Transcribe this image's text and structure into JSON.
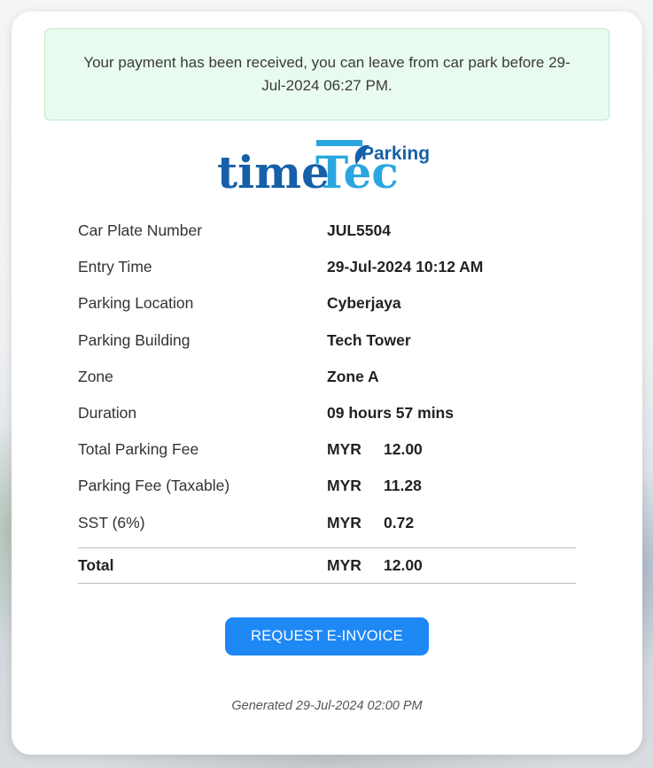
{
  "alert": {
    "message": "Your payment has been received, you can leave from car park before 29-Jul-2024 06:27 PM."
  },
  "logo": {
    "word_time": "time",
    "word_tec": "Tec",
    "word_parking": "Parking",
    "colors": {
      "dark_blue": "#1560a8",
      "light_blue": "#2aa6e0"
    }
  },
  "details": {
    "car_plate": {
      "label": "Car Plate Number",
      "value": "JUL5504"
    },
    "entry_time": {
      "label": "Entry Time",
      "value": "29-Jul-2024 10:12 AM"
    },
    "location": {
      "label": "Parking Location",
      "value": "Cyberjaya"
    },
    "building": {
      "label": "Parking Building",
      "value": "Tech Tower"
    },
    "zone": {
      "label": "Zone",
      "value": "Zone A"
    },
    "duration": {
      "label": "Duration",
      "value": "09 hours 57 mins"
    },
    "total_fee": {
      "label": "Total Parking Fee",
      "currency": "MYR",
      "amount": "12.00"
    },
    "taxable_fee": {
      "label": "Parking Fee (Taxable)",
      "currency": "MYR",
      "amount": "11.28"
    },
    "sst": {
      "label": "SST (6%)",
      "currency": "MYR",
      "amount": "0.72"
    },
    "total": {
      "label": "Total",
      "currency": "MYR",
      "amount": "12.00"
    }
  },
  "actions": {
    "request_einvoice_label": "REQUEST E-INVOICE",
    "button_color": "#1e88f5"
  },
  "footer": {
    "generated_text": "Generated 29-Jul-2024 02:00 PM"
  }
}
